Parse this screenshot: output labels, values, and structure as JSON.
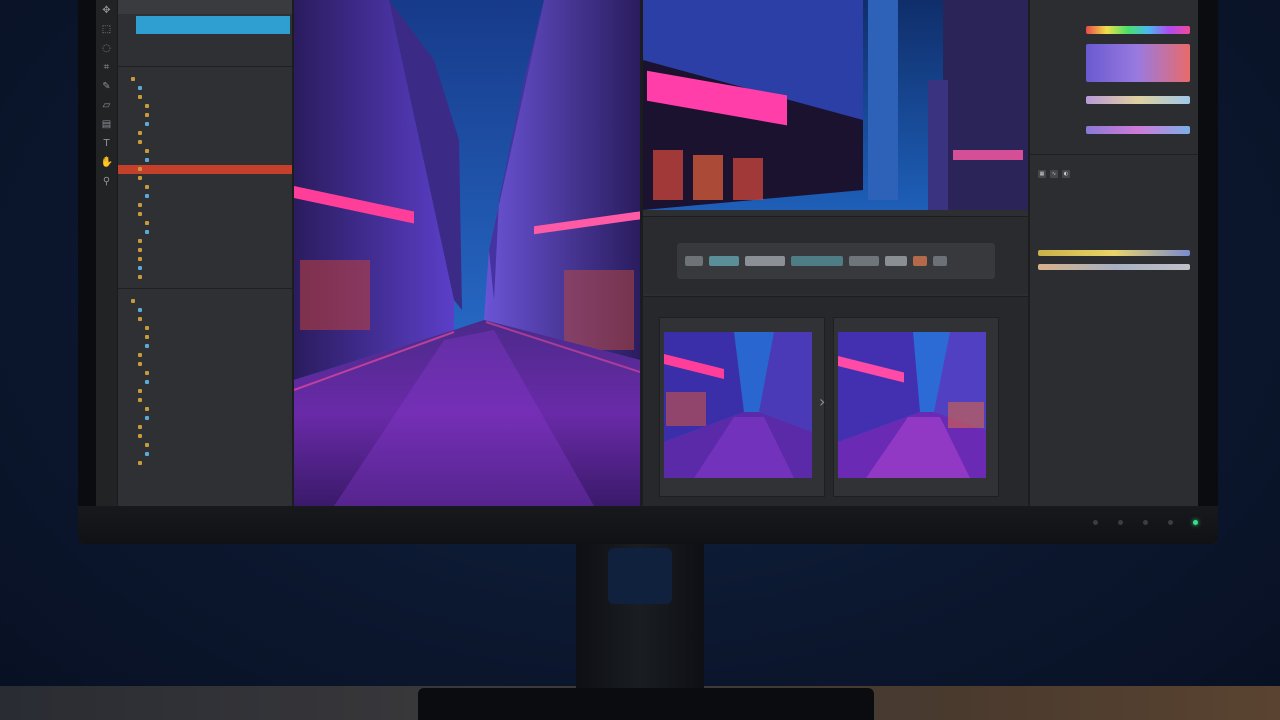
{
  "left_panel": {
    "header": "",
    "selected_item": "",
    "selected_sub": "",
    "section1_title": "",
    "section2_title": "",
    "tree1": [
      "",
      "",
      "",
      "",
      "",
      "",
      "",
      "",
      "",
      "",
      "",
      "",
      "",
      "",
      "",
      "",
      "",
      "",
      "",
      "",
      "",
      "",
      ""
    ],
    "tree2": [
      "",
      "",
      "",
      "",
      "",
      "",
      "",
      "",
      "",
      "",
      "",
      "",
      "",
      "",
      "",
      "",
      "",
      "",
      ""
    ]
  },
  "center": {
    "filmstrip_title": "",
    "compare_title": "",
    "compare_left_label": "",
    "compare_right_label": "",
    "compare_foot": ""
  },
  "right_panel": {
    "title": "",
    "section_title": "",
    "lines": [
      "",
      "",
      "",
      "",
      "",
      ""
    ]
  },
  "icons": {
    "toolbar": [
      "move-icon",
      "marquee-icon",
      "lasso-icon",
      "crop-icon",
      "brush-icon",
      "eraser-icon",
      "gradient-icon",
      "text-icon",
      "hand-icon",
      "zoom-icon"
    ],
    "compare_arrow": "chevron-right-icon"
  },
  "colors": {
    "selection_blue": "#2f9fd1",
    "active_row_red": "#c4402a",
    "power_led": "#35e08a",
    "neon_pink": "#ff3e9a",
    "sky_blue": "#2d7fe0"
  }
}
